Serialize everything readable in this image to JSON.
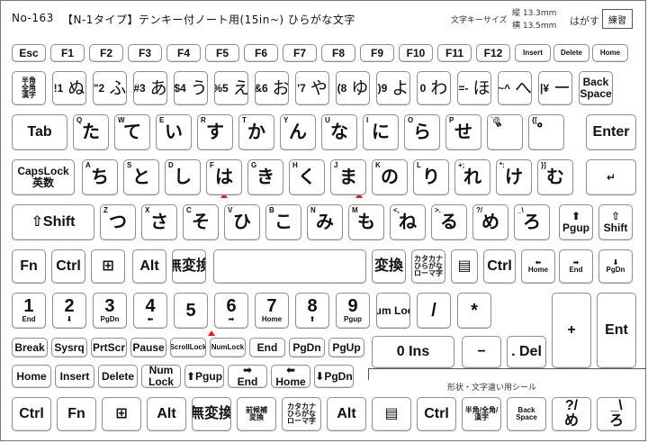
{
  "header": {
    "product_code": "No-163",
    "title": "【N-1タイプ】テンキー付ノート用(15in~) ひらがな文字",
    "font_size_label": "文字キーサイズ",
    "height_size": "縦 13.3mm",
    "width_size": "横 13.5mm",
    "peel_label": "はがす",
    "practice_button": "練習"
  },
  "caption": "形状・文字違い用シール",
  "rows": {
    "fn": [
      "Esc",
      "F1",
      "F2",
      "F3",
      "F4",
      "F5",
      "F6",
      "F7",
      "F8",
      "F9",
      "F10",
      "F11",
      "F12",
      "Insert",
      "Delete",
      "Home"
    ],
    "num": [
      {
        "main": "半角/全角/漢字",
        "kana": ""
      },
      {
        "main": "!1",
        "kana": "ぬ"
      },
      {
        "main": "\"2",
        "kana": "ふ"
      },
      {
        "main": "#3",
        "kana": "あ"
      },
      {
        "main": "$4",
        "kana": "う"
      },
      {
        "main": "%5",
        "kana": "え"
      },
      {
        "main": "&6",
        "kana": "お"
      },
      {
        "main": "'7",
        "kana": "や"
      },
      {
        "main": "(8",
        "kana": "ゆ"
      },
      {
        "main": ")9",
        "kana": "よ"
      },
      {
        "main": "0",
        "kana": "わ"
      },
      {
        "main": "=-",
        "kana": "ほ"
      },
      {
        "main": "~^",
        "kana": "へ"
      },
      {
        "main": "|¥",
        "kana": "ー"
      },
      {
        "main": "Back Space",
        "kana": ""
      }
    ],
    "top": [
      {
        "corner": "",
        "main": "Tab",
        "kana": ""
      },
      {
        "corner": "Q",
        "kana": "た"
      },
      {
        "corner": "W",
        "kana": "て"
      },
      {
        "corner": "E",
        "kana": "い"
      },
      {
        "corner": "R",
        "kana": "す"
      },
      {
        "corner": "T",
        "kana": "か"
      },
      {
        "corner": "Y",
        "kana": "ん"
      },
      {
        "corner": "U",
        "kana": "な"
      },
      {
        "corner": "I",
        "kana": "に"
      },
      {
        "corner": "O",
        "kana": "ら"
      },
      {
        "corner": "P",
        "kana": "せ"
      },
      {
        "corner": "`@",
        "kana": "゛"
      },
      {
        "corner": "{[",
        "kana": "゜"
      },
      {
        "corner": "",
        "main": "Enter",
        "kana": ""
      }
    ],
    "home": [
      {
        "corner": "",
        "main": "CapsLock 英数",
        "kana": ""
      },
      {
        "corner": "A",
        "kana": "ち"
      },
      {
        "corner": "S",
        "kana": "と"
      },
      {
        "corner": "D",
        "kana": "し"
      },
      {
        "corner": "F",
        "kana": "は"
      },
      {
        "corner": "G",
        "kana": "き"
      },
      {
        "corner": "H",
        "kana": "く"
      },
      {
        "corner": "J",
        "kana": "ま"
      },
      {
        "corner": "K",
        "kana": "の"
      },
      {
        "corner": "L",
        "kana": "り"
      },
      {
        "corner": "+;",
        "kana": "れ"
      },
      {
        "corner": "*:",
        "kana": "け"
      },
      {
        "corner": "}]",
        "kana": "む"
      },
      {
        "corner": "",
        "main": "↵",
        "kana": ""
      }
    ],
    "bottom": [
      {
        "corner": "",
        "main": "⇧Shift",
        "kana": ""
      },
      {
        "corner": "Z",
        "kana": "つ"
      },
      {
        "corner": "X",
        "kana": "さ"
      },
      {
        "corner": "C",
        "kana": "そ"
      },
      {
        "corner": "V",
        "kana": "ひ"
      },
      {
        "corner": "B",
        "kana": "こ"
      },
      {
        "corner": "N",
        "kana": "み"
      },
      {
        "corner": "M",
        "kana": "も"
      },
      {
        "corner": "<,",
        "kana": "ね"
      },
      {
        "corner": ">.",
        "kana": "る"
      },
      {
        "corner": "?/",
        "kana": "め"
      },
      {
        "corner": "_\\",
        "kana": "ろ"
      },
      {
        "corner": "",
        "main": "⬆ Pgup",
        "kana": ""
      },
      {
        "corner": "",
        "main": "⇧ Shift",
        "kana": ""
      }
    ],
    "space": [
      "Fn",
      "Ctrl",
      "⊞",
      "Alt",
      "無変換",
      "",
      "変換",
      "カタカナ ひらがな ローマ字",
      "▤",
      "Ctrl",
      "⬅ Home",
      "➡ End",
      "⬇ PgDn"
    ],
    "numpad": [
      {
        "main": "1",
        "sub": "End"
      },
      {
        "main": "2",
        "sub": "⬇"
      },
      {
        "main": "3",
        "sub": "PgDn"
      },
      {
        "main": "4",
        "sub": "⬅"
      },
      {
        "main": "5",
        "sub": ""
      },
      {
        "main": "6",
        "sub": "➡"
      },
      {
        "main": "7",
        "sub": "Home"
      },
      {
        "main": "8",
        "sub": "⬆"
      },
      {
        "main": "9",
        "sub": "Pgup"
      },
      {
        "main": "Num Lock",
        "sub": ""
      },
      {
        "main": "/",
        "sub": ""
      },
      {
        "main": "*",
        "sub": ""
      }
    ],
    "util": [
      "Break",
      "Sysrq",
      "PrtScr",
      "Pause",
      "ScrollLock",
      "NumLock",
      "End",
      "PgDn",
      "PgUp"
    ],
    "nav": [
      "Home",
      "Insert",
      "Delete",
      "Num Lock",
      "⬆Pgup",
      "➡ End",
      "⬅ Home",
      "⬇PgDn"
    ],
    "extra": [
      "Ctrl",
      "Fn",
      "⊞",
      "Alt",
      "無変換",
      "前候補 変換",
      "カタカナ ひらがな ローマ字",
      "Alt",
      "▤",
      "Ctrl",
      "半角/全角/漢字",
      "Back Space",
      "?/ め",
      "_\\ ろ"
    ],
    "pad_ops": {
      "minus": "−",
      "plus": "+",
      "ent": "Ent",
      "ins": "0 Ins",
      "del": ". Del"
    }
  }
}
